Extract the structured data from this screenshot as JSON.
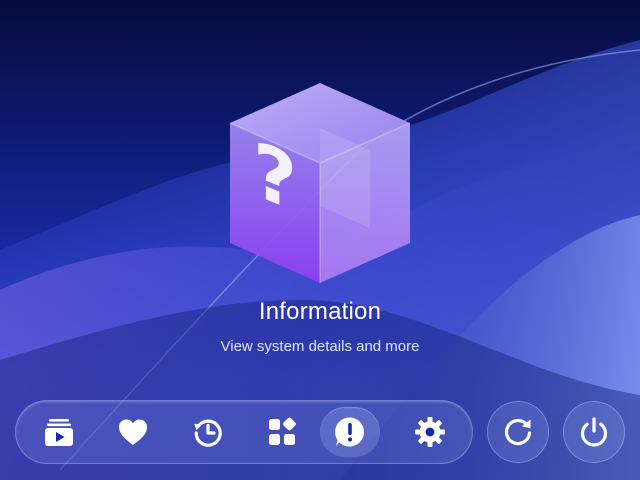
{
  "hero": {
    "icon": "question-cube-icon",
    "title": "Information",
    "subtitle": "View system details and more"
  },
  "dock": {
    "items": [
      {
        "icon": "media-library-icon",
        "selected": false
      },
      {
        "icon": "heart-icon",
        "selected": false
      },
      {
        "icon": "history-icon",
        "selected": false
      },
      {
        "icon": "apps-icon",
        "selected": false
      },
      {
        "icon": "info-alert-icon",
        "selected": true
      },
      {
        "icon": "gear-icon",
        "selected": false
      }
    ]
  },
  "actions": [
    {
      "icon": "refresh-icon"
    },
    {
      "icon": "power-icon"
    }
  ],
  "colors": {
    "background_top": "#070b3d",
    "background_mid": "#1a2aa6",
    "cube_purple": "#a07af5",
    "icon_white": "#ffffff"
  }
}
